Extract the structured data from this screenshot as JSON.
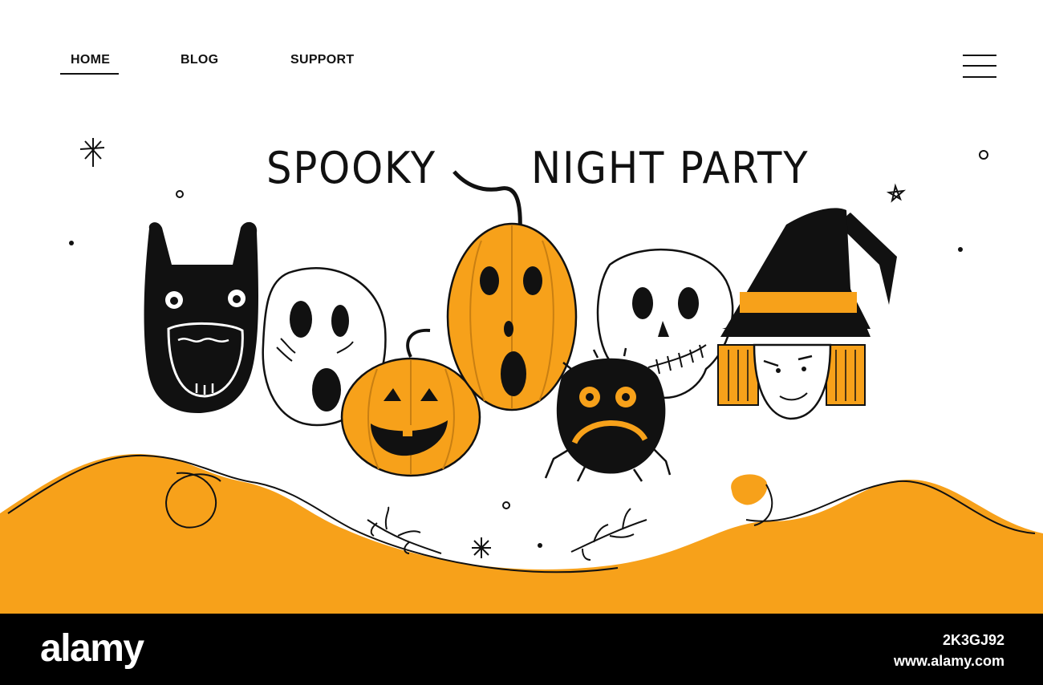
{
  "nav": {
    "items": [
      {
        "label": "HOME",
        "active": true
      },
      {
        "label": "BLOG",
        "active": false
      },
      {
        "label": "SUPPORT",
        "active": false
      }
    ],
    "menu_icon": "hamburger-menu-icon"
  },
  "hero": {
    "headline_left": "SPOOKY",
    "headline_right": "NIGHT PARTY",
    "characters": [
      "bat-mask",
      "ghost",
      "small-pumpkin",
      "tall-pumpkin",
      "spider",
      "skull",
      "witch"
    ]
  },
  "watermark": {
    "brand": "alamy",
    "image_id": "2K3GJ92",
    "site": "www.alamy.com"
  },
  "colors": {
    "accent": "#F7A11A",
    "ink": "#111111",
    "background": "#FFFFFF",
    "footer": "#000000"
  }
}
